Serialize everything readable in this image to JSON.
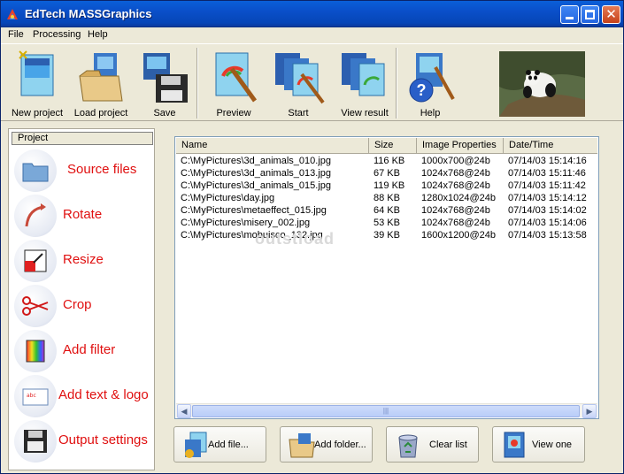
{
  "window": {
    "title": "EdTech MASSGraphics"
  },
  "menu": [
    "File",
    "Processing",
    "Help"
  ],
  "toolbar": {
    "new_project": "New project",
    "load_project": "Load project",
    "save": "Save",
    "preview": "Preview",
    "start": "Start",
    "view_result": "View result",
    "help": "Help"
  },
  "project": {
    "header": "Project",
    "tasks": [
      "Source files",
      "Rotate",
      "Resize",
      "Crop",
      "Add filter",
      "Add text & logo",
      "Output settings"
    ]
  },
  "list": {
    "columns": [
      "Name",
      "Size",
      "Image Properties",
      "Date/Time"
    ],
    "rows": [
      [
        "C:\\MyPictures\\3d_animals_010.jpg",
        "116 KB",
        "1000x700@24b",
        "07/14/03 15:14:16"
      ],
      [
        "C:\\MyPictures\\3d_animals_013.jpg",
        "67 KB",
        "1024x768@24b",
        "07/14/03 15:11:46"
      ],
      [
        "C:\\MyPictures\\3d_animals_015.jpg",
        "119 KB",
        "1024x768@24b",
        "07/14/03 15:11:42"
      ],
      [
        "C:\\MyPictures\\day.jpg",
        "88 KB",
        "1280x1024@24b",
        "07/14/03 15:14:12"
      ],
      [
        "C:\\MyPictures\\metaeffect_015.jpg",
        "64 KB",
        "1024x768@24b",
        "07/14/03 15:14:02"
      ],
      [
        "C:\\MyPictures\\misery_002.jpg",
        "53 KB",
        "1024x768@24b",
        "07/14/03 15:14:06"
      ],
      [
        "C:\\MyPictures\\mobuisco_132.jpg",
        "39 KB",
        "1600x1200@24b",
        "07/14/03 15:13:58"
      ]
    ],
    "watermark": "outstload"
  },
  "buttons": {
    "add_file": "Add file...",
    "add_folder": "Add folder...",
    "clear_list": "Clear list",
    "view_one": "View one"
  },
  "colors": {
    "task_text": "#e01010",
    "titlebar": "#0a4fc9"
  }
}
